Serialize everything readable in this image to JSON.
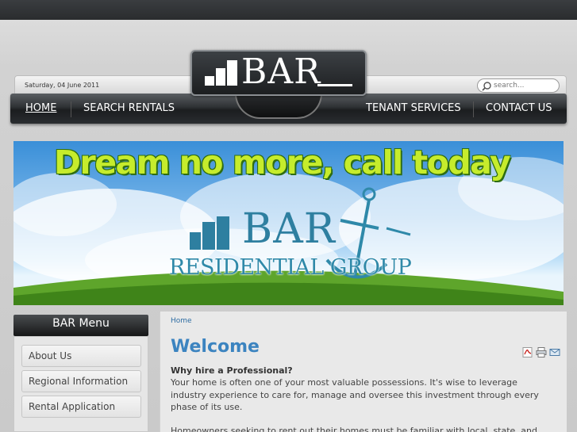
{
  "header": {
    "date": "Saturday, 04 June 2011",
    "search_placeholder": "search...",
    "logo_text": "BAR"
  },
  "nav": {
    "items": [
      {
        "label": "HOME"
      },
      {
        "label": "SEARCH RENTALS"
      },
      {
        "label": "TENANT SERVICES"
      },
      {
        "label": "CONTACT US"
      }
    ]
  },
  "banner": {
    "headline": "Dream no more, call today",
    "brand": "BAR",
    "brand_sub": "RESIDENTIAL GROUP"
  },
  "sidebar": {
    "title": "BAR Menu",
    "items": [
      {
        "label": "About Us"
      },
      {
        "label": "Regional Information"
      },
      {
        "label": "Rental Application"
      }
    ]
  },
  "main": {
    "breadcrumb": "Home",
    "title": "Welcome",
    "subheading": "Why hire a Professional?",
    "paragraph1": "Your home is often one of your most valuable possessions. It's wise to leverage industry experience to care for, manage and oversee this investment through every phase of its use.",
    "paragraph2": "Homeowners seeking to rent out their homes must be familiar with local, state, and",
    "icons": [
      "pdf-icon",
      "print-icon",
      "email-icon"
    ]
  },
  "colors": {
    "accent": "#3c84c0",
    "nav_bg": "#1b1d1f",
    "headline_green": "#c6ec2c",
    "brand_blue": "#2e7fa0"
  }
}
